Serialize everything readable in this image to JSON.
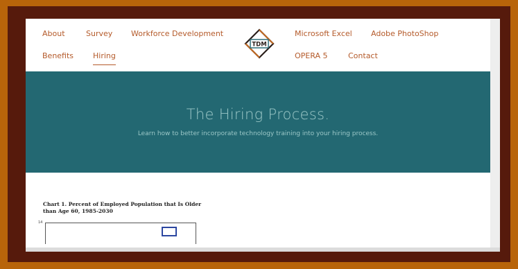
{
  "nav": {
    "left_row1": [
      "About",
      "Survey",
      "Workforce Development"
    ],
    "left_row2": [
      "Benefits",
      "Hiring"
    ],
    "right_row1": [
      "Microsoft Excel",
      "Adobe PhotoShop"
    ],
    "right_row2": [
      "OPERA 5",
      "Contact"
    ],
    "active": "Hiring"
  },
  "logo": {
    "text": "TDM"
  },
  "hero": {
    "title": "The Hiring Process.",
    "subtitle": "Learn how to better incorporate technology training into your hiring process."
  },
  "chart_preview": {
    "title": "Chart 1.  Percent of Employed Population that Is Older than Age 60, 1985-2030",
    "y_top_tick": "14"
  },
  "colors": {
    "frame_outer": "#b8640a",
    "frame_inner": "#561a0c",
    "nav_link": "#b45a2a",
    "hero_bg": "#236872",
    "hero_text": "#9bc7c7",
    "logo_dark": "#2a1e1a",
    "logo_orange": "#c06a25",
    "logo_teal": "#2f6e78",
    "chart_legend": "#2b46a0"
  }
}
